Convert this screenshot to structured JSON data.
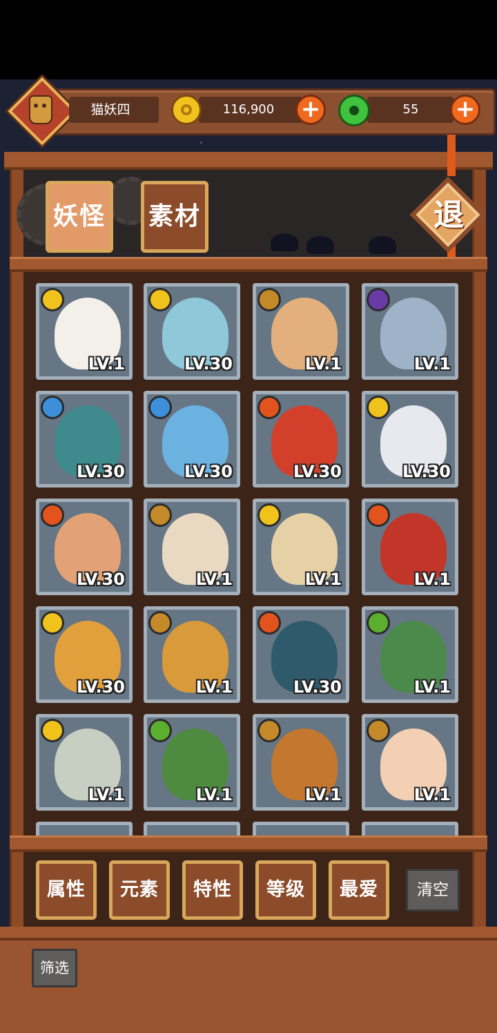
{
  "header": {
    "player_name": "猫妖四",
    "coins": "116,900",
    "jade": "55",
    "add_coins_icon": "plus-icon",
    "add_jade_icon": "plus-icon"
  },
  "tabs": [
    {
      "label": "妖怪",
      "active": true
    },
    {
      "label": "素材",
      "active": false
    }
  ],
  "exit_label": "退",
  "colors": {
    "wood": "#a2582f",
    "wood_dark": "#6a3618",
    "tab_active": "#e39a69",
    "tab_inactive": "#8c4b2a",
    "tile_frame": "#a3b0bb",
    "coin": "#f2c31e",
    "jade": "#3fc33e",
    "plus": "#ef6a1f"
  },
  "monsters": [
    {
      "element": "sun",
      "level": "LV.1",
      "color": "#f3f0ea"
    },
    {
      "element": "sun",
      "level": "LV.30",
      "color": "#8fc8d9"
    },
    {
      "element": "earth",
      "level": "LV.1",
      "color": "#e3b07d"
    },
    {
      "element": "moon",
      "level": "LV.1",
      "color": "#9fb3c8"
    },
    {
      "element": "water",
      "level": "LV.30",
      "color": "#3f8a8c"
    },
    {
      "element": "water",
      "level": "LV.30",
      "color": "#6bb2e0"
    },
    {
      "element": "fire",
      "level": "LV.30",
      "color": "#d2402c"
    },
    {
      "element": "sun",
      "level": "LV.30",
      "color": "#e8e8ef"
    },
    {
      "element": "fire",
      "level": "LV.30",
      "color": "#e2a276"
    },
    {
      "element": "earth",
      "level": "LV.1",
      "color": "#ead9c2"
    },
    {
      "element": "sun",
      "level": "LV.1",
      "color": "#e6d0a6"
    },
    {
      "element": "fire",
      "level": "LV.1",
      "color": "#c2362a"
    },
    {
      "element": "sun",
      "level": "LV.30",
      "color": "#e2a03c"
    },
    {
      "element": "earth",
      "level": "LV.1",
      "color": "#d89a3a"
    },
    {
      "element": "fire",
      "level": "LV.30",
      "color": "#2e5a6b"
    },
    {
      "element": "wood",
      "level": "LV.1",
      "color": "#4b8a4a"
    },
    {
      "element": "sun",
      "level": "LV.1",
      "color": "#c7cfc2"
    },
    {
      "element": "wood",
      "level": "LV.1",
      "color": "#4e8a40"
    },
    {
      "element": "earth",
      "level": "LV.1",
      "color": "#c4772e"
    },
    {
      "element": "earth",
      "level": "LV.1",
      "color": "#f3d0b4"
    }
  ],
  "filters": [
    {
      "label": "属性"
    },
    {
      "label": "元素"
    },
    {
      "label": "特性"
    },
    {
      "label": "等级"
    },
    {
      "label": "最爱"
    }
  ],
  "clear_label": "清空",
  "screen_label": "筛选"
}
